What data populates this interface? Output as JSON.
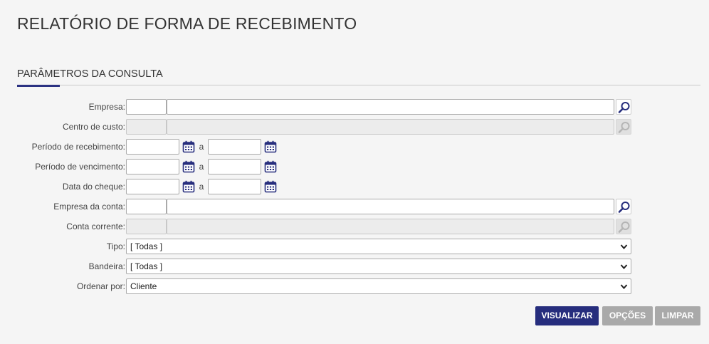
{
  "page": {
    "title": "RELATÓRIO DE FORMA DE RECEBIMENTO",
    "section_title": "PARÂMETROS DA CONSULTA"
  },
  "form": {
    "empresa": {
      "label": "Empresa:",
      "code": "",
      "name": ""
    },
    "centro_custo": {
      "label": "Centro de custo:",
      "code": "",
      "name": ""
    },
    "periodo_recebimento": {
      "label": "Período de recebimento:",
      "from": "",
      "sep": "a",
      "to": ""
    },
    "periodo_vencimento": {
      "label": "Período de vencimento:",
      "from": "",
      "sep": "a",
      "to": ""
    },
    "data_cheque": {
      "label": "Data do cheque:",
      "from": "",
      "sep": "a",
      "to": ""
    },
    "empresa_conta": {
      "label": "Empresa da conta:",
      "code": "",
      "name": ""
    },
    "conta_corrente": {
      "label": "Conta corrente:",
      "code": "",
      "name": ""
    },
    "tipo": {
      "label": "Tipo:",
      "selected": "[ Todas ]"
    },
    "bandeira": {
      "label": "Bandeira:",
      "selected": "[ Todas ]"
    },
    "ordenar_por": {
      "label": "Ordenar por:",
      "selected": "Cliente"
    }
  },
  "actions": {
    "visualizar": "VISUALIZAR",
    "opcoes": "OPÇÕES",
    "limpar": "LIMPAR"
  },
  "icons": {
    "lookup": "magnifier-icon",
    "calendar": "calendar-icon",
    "dropdown": "chevron-down-icon"
  },
  "colors": {
    "primary": "#262d7d",
    "secondary_button": "#a9a9a9",
    "accent": "#2b3282"
  }
}
